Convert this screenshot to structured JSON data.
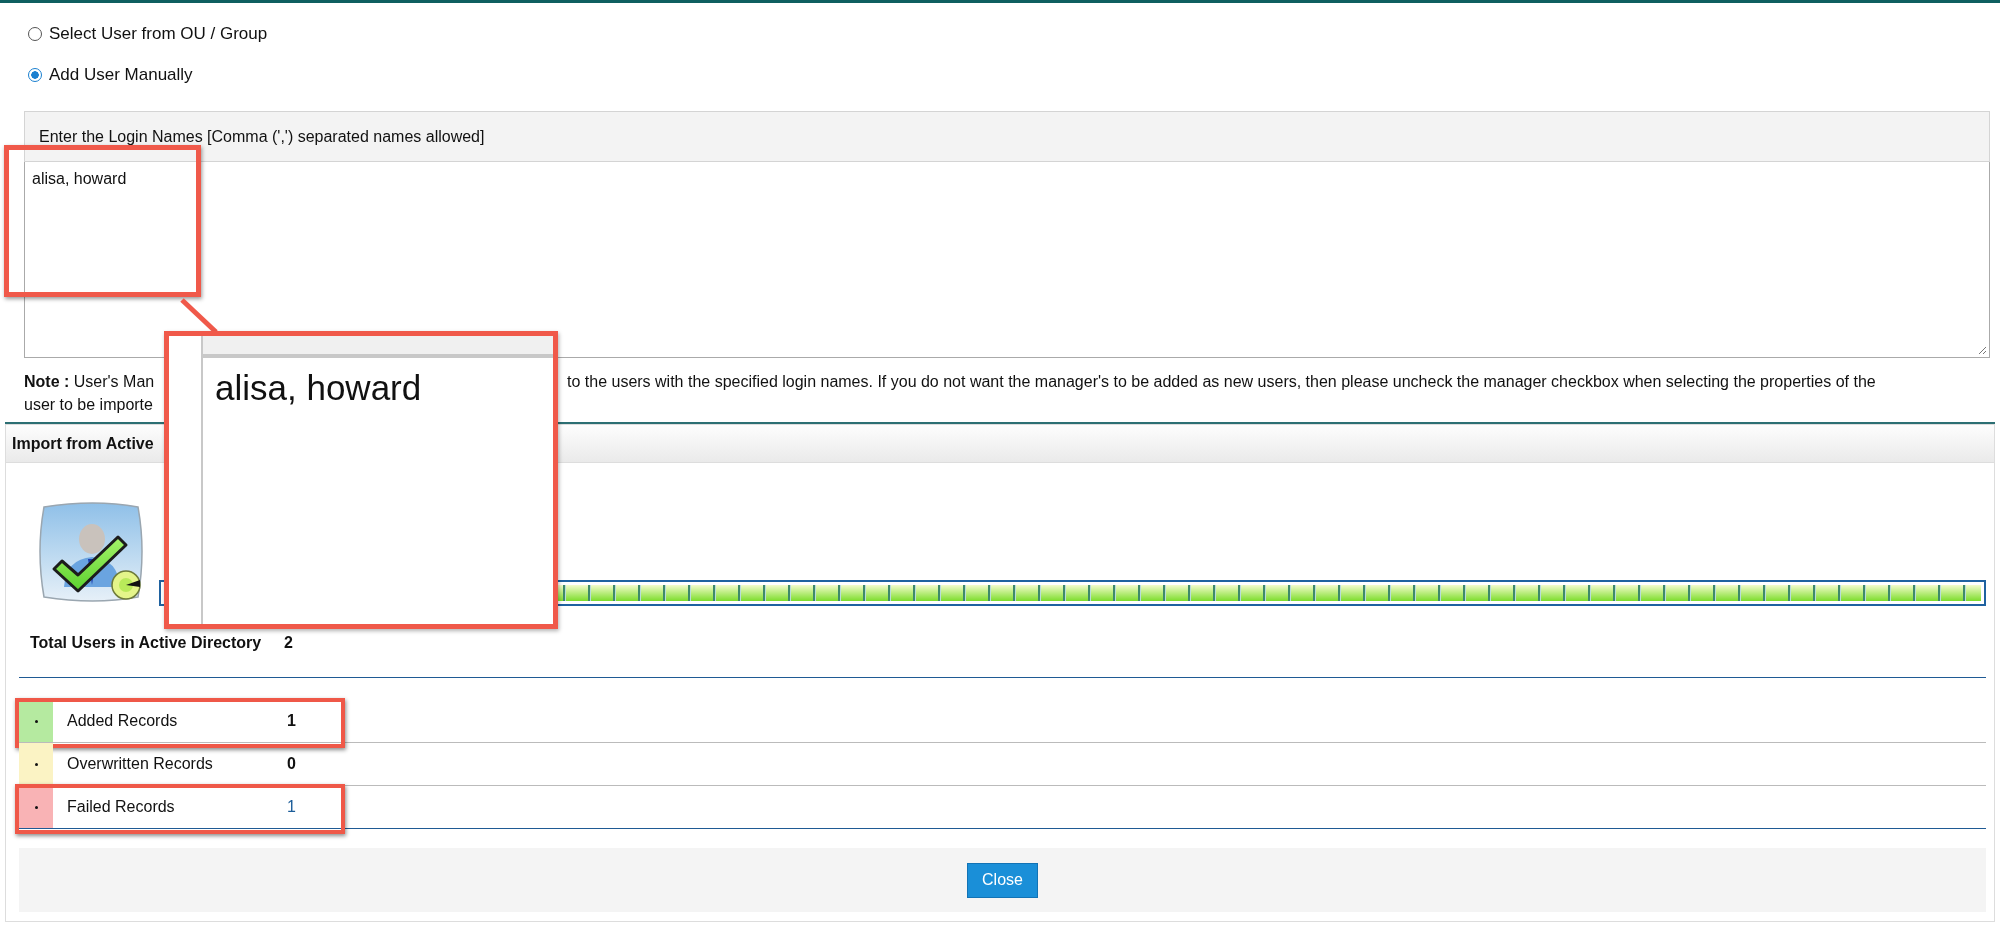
{
  "radios": [
    {
      "label": "Select User from OU / Group",
      "selected": false
    },
    {
      "label": "Add User Manually",
      "selected": true
    }
  ],
  "login_names": {
    "header": "Enter the Login Names [Comma (',') separated names allowed]",
    "value": "alisa, howard"
  },
  "note": {
    "line1_left": "**Note :** User's Man",
    "line1_right": "to the users with the specified login names. If you do not want the manager's to be added as new users, then please uncheck the manager checkbox when selecting the properties of the",
    "line2": "user to be importe"
  },
  "import_panel": {
    "title": "Import from Active",
    "progress": {
      "level": 1
    },
    "total": {
      "label": "Total Users in Active Directory",
      "value": "2"
    },
    "records": [
      {
        "label": "Added Records",
        "value": "1",
        "color": "#b5eaa0",
        "kind": "count",
        "highlighted": true
      },
      {
        "label": "Overwritten Records",
        "value": "0",
        "color": "#fbf3c4",
        "kind": "count",
        "highlighted": false
      },
      {
        "label": "Failed Records",
        "value": "1",
        "color": "#f9b3b5",
        "kind": "link",
        "highlighted": true
      }
    ]
  },
  "callout": {
    "text": "alisa, howard"
  },
  "buttons": [
    {
      "label": "Close"
    }
  ]
}
